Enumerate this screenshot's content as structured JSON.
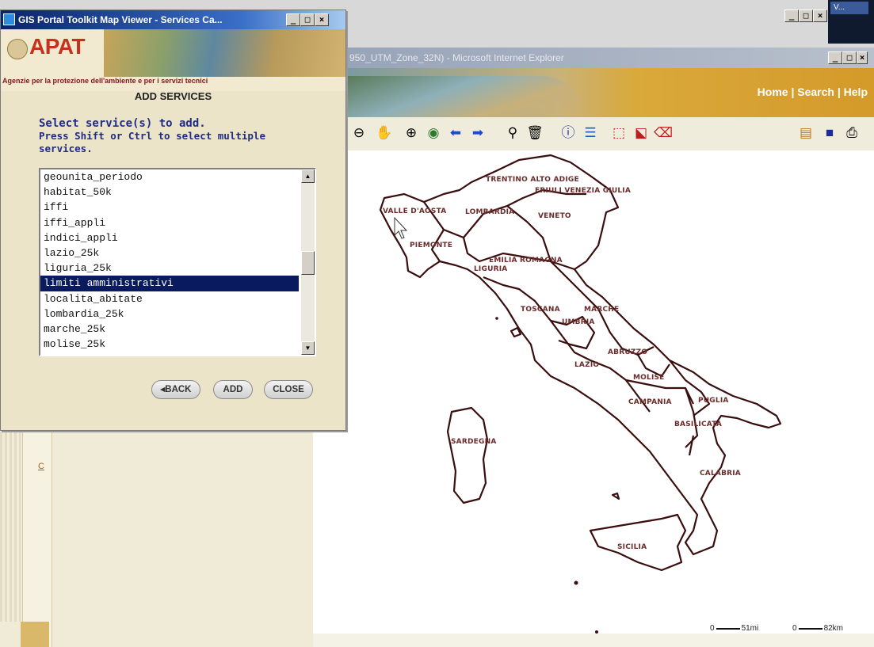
{
  "desktop": {
    "taskbar_label": "V..."
  },
  "ie_window": {
    "title": "950_UTM_Zone_32N) - Microsoft Internet Explorer",
    "nav_links": "Home | Search | Help"
  },
  "dialog": {
    "title": "GIS Portal Toolkit Map Viewer - Services Ca...",
    "logo_text": "APAT",
    "agency_text": "Agenzie per la protezione dell'ambiente e per i servizi tecnici",
    "heading": "ADD SERVICES",
    "prompt_line1": "Select service(s) to add.",
    "prompt_line2": "Press Shift or Ctrl to select multiple",
    "prompt_line3": "services.",
    "services": [
      "geounita_periodo",
      "habitat_50k",
      "iffi",
      "iffi_appli",
      "indici_appli",
      "lazio_25k",
      "liguria_25k",
      "limiti amministrativi",
      "localita_abitate",
      "lombardia_25k",
      "marche_25k",
      "molise_25k"
    ],
    "selected_service": "limiti amministrativi",
    "buttons": {
      "back": "◂BACK",
      "add": "ADD",
      "close": "CLOSE"
    }
  },
  "left_frame": {
    "link": "C"
  },
  "map": {
    "regions": {
      "trentino": "TRENTINO ALTO ADIGE",
      "friuli": "FRIULI VENEZIA GIULIA",
      "valle": "VALLE D'AOSTA",
      "lombardia": "LOMBARDIA",
      "veneto": "VENETO",
      "piemonte": "PIEMONTE",
      "emilia": "EMILIA ROMAGNA",
      "liguria": "LIGURIA",
      "toscana": "TOSCANA",
      "marche": "MARCHE",
      "umbria": "UMBRIA",
      "abruzzo": "ABRUZZO",
      "lazio": "LAZIO",
      "molise": "MOLISE",
      "campania": "CAMPANIA",
      "puglia": "PUGLIA",
      "basilicata": "BASILICATA",
      "sardegna": "SARDEGNA",
      "calabria": "CALABRIA",
      "sicilia": "SICILIA"
    },
    "scale_mi": "51mi",
    "scale_km": "82km",
    "scale_zero": "0"
  }
}
